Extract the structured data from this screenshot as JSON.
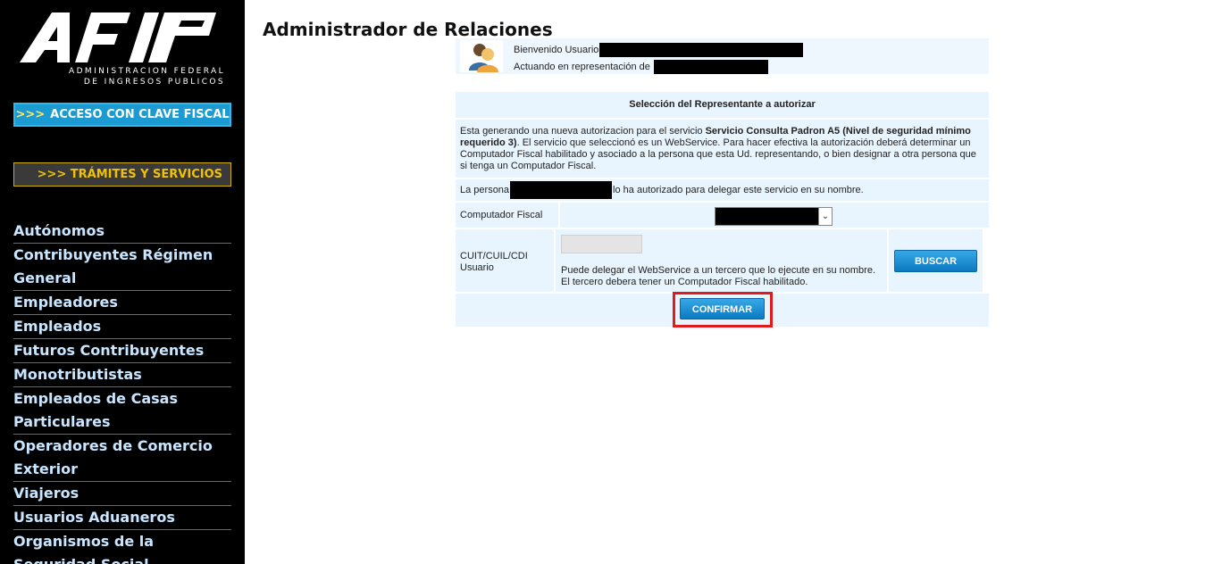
{
  "sidebar": {
    "logo_subtitle_line1": "ADMINISTRACION FEDERAL",
    "logo_subtitle_line2": "DE INGRESOS PUBLICOS",
    "clave_arrows": ">>>",
    "clave_label": "ACCESO CON CLAVE FISCAL",
    "tramites_label": ">>> TRÁMITES Y SERVICIOS",
    "nav": [
      "Autónomos",
      "Contribuyentes Régimen General",
      "Empleadores",
      "Empleados",
      "Futuros Contribuyentes",
      "Monotributistas",
      "Empleados de Casas Particulares",
      "Operadores de Comercio Exterior",
      "Viajeros",
      "Usuarios Aduaneros",
      "Organismos de la Seguridad Social"
    ]
  },
  "main": {
    "title": "Administrador de Relaciones",
    "welcome_user_label": "Bienvenido Usuario",
    "representing_label": "Actuando en representación de",
    "section_header": "Selección del Representante a autorizar",
    "desc_prefix": "Esta generando una nueva autorizacion para el servicio ",
    "desc_service": "Servicio Consulta Padron A5 (Nivel de seguridad mínimo requerido 3)",
    "desc_suffix": ". El servicio que seleccionó es un WebService. Para hacer efectiva la autorización deberá determinar un Computador Fiscal habilitado y asociado a la persona que esta Ud. representando, o bien designar a otra persona que si tenga un Computador Fiscal.",
    "persona_prefix": "La persona",
    "persona_suffix": "lo ha autorizado para delegar este servicio en su nombre.",
    "computador_label": "Computador Fiscal",
    "cuit_label": "CUIT/CUIL/CDI Usuario",
    "cuit_note": "Puede delegar el WebService a un tercero que lo ejecute en su nombre. El tercero debera tener un Computador Fiscal habilitado.",
    "buscar_label": "BUSCAR",
    "confirmar_label": "CONFIRMAR"
  },
  "colors": {
    "sidebar_bg": "#000000",
    "nav_text": "#c8e6ff",
    "clave_bg": "#1b9bd1",
    "tramites_text": "#f2c200",
    "panel_bg": "#e9f5fe",
    "button_blue": "#0c79c2",
    "highlight": "#e01b1b"
  },
  "icons": [
    "users-avatar-icon",
    "chevron-down-icon"
  ]
}
